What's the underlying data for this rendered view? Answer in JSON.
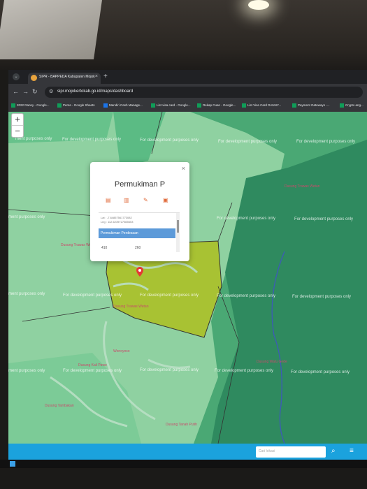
{
  "browser": {
    "tab_title": "SIPR - BAPPEDA Kabupaten Mojok",
    "url": "sipr.mojokertokab.go.id/maps/dashboard",
    "bookmarks": [
      {
        "label": "2022 Danny - Google..."
      },
      {
        "label": "Pema - Google Sheets"
      },
      {
        "label": "Mandiri Cash Manage..."
      },
      {
        "label": "List visa card - Google..."
      },
      {
        "label": "Rekap Cuan - Google..."
      },
      {
        "label": "List Visa Card DANNY..."
      },
      {
        "label": "Payment Gateways -..."
      },
      {
        "label": "Crypto ang..."
      }
    ]
  },
  "map": {
    "watermark": "For development purposes only",
    "watermark_partial": "ment purposes only",
    "places": [
      "Dusung Trawas Wetan",
      "Dusung Trawas Wetan",
      "Dusung Trawas Wetan",
      "Wonoyoso",
      "Dusung Watu Gede",
      "Dusung Kali Pawe",
      "Dusung Tambakan",
      "Dusung Tanah Putih"
    ],
    "zoom_in": "+",
    "zoom_out": "−"
  },
  "popup": {
    "title": "Permukiman P",
    "close": "×",
    "coords": [
      "Lat : -7.64857561773082",
      "Lng : 112.6239727365653"
    ],
    "row_label": "Permukiman Perdesaan",
    "values": [
      "410",
      "260"
    ]
  },
  "bottombar": {
    "search_placeholder": "Cari lokasi"
  },
  "colors": {
    "map_light": "#8fd1a1",
    "map_mid": "#5bbb84",
    "map_dark": "#2f8a5f",
    "highlight": "#a8c233",
    "accent": "#1ba2dd"
  }
}
